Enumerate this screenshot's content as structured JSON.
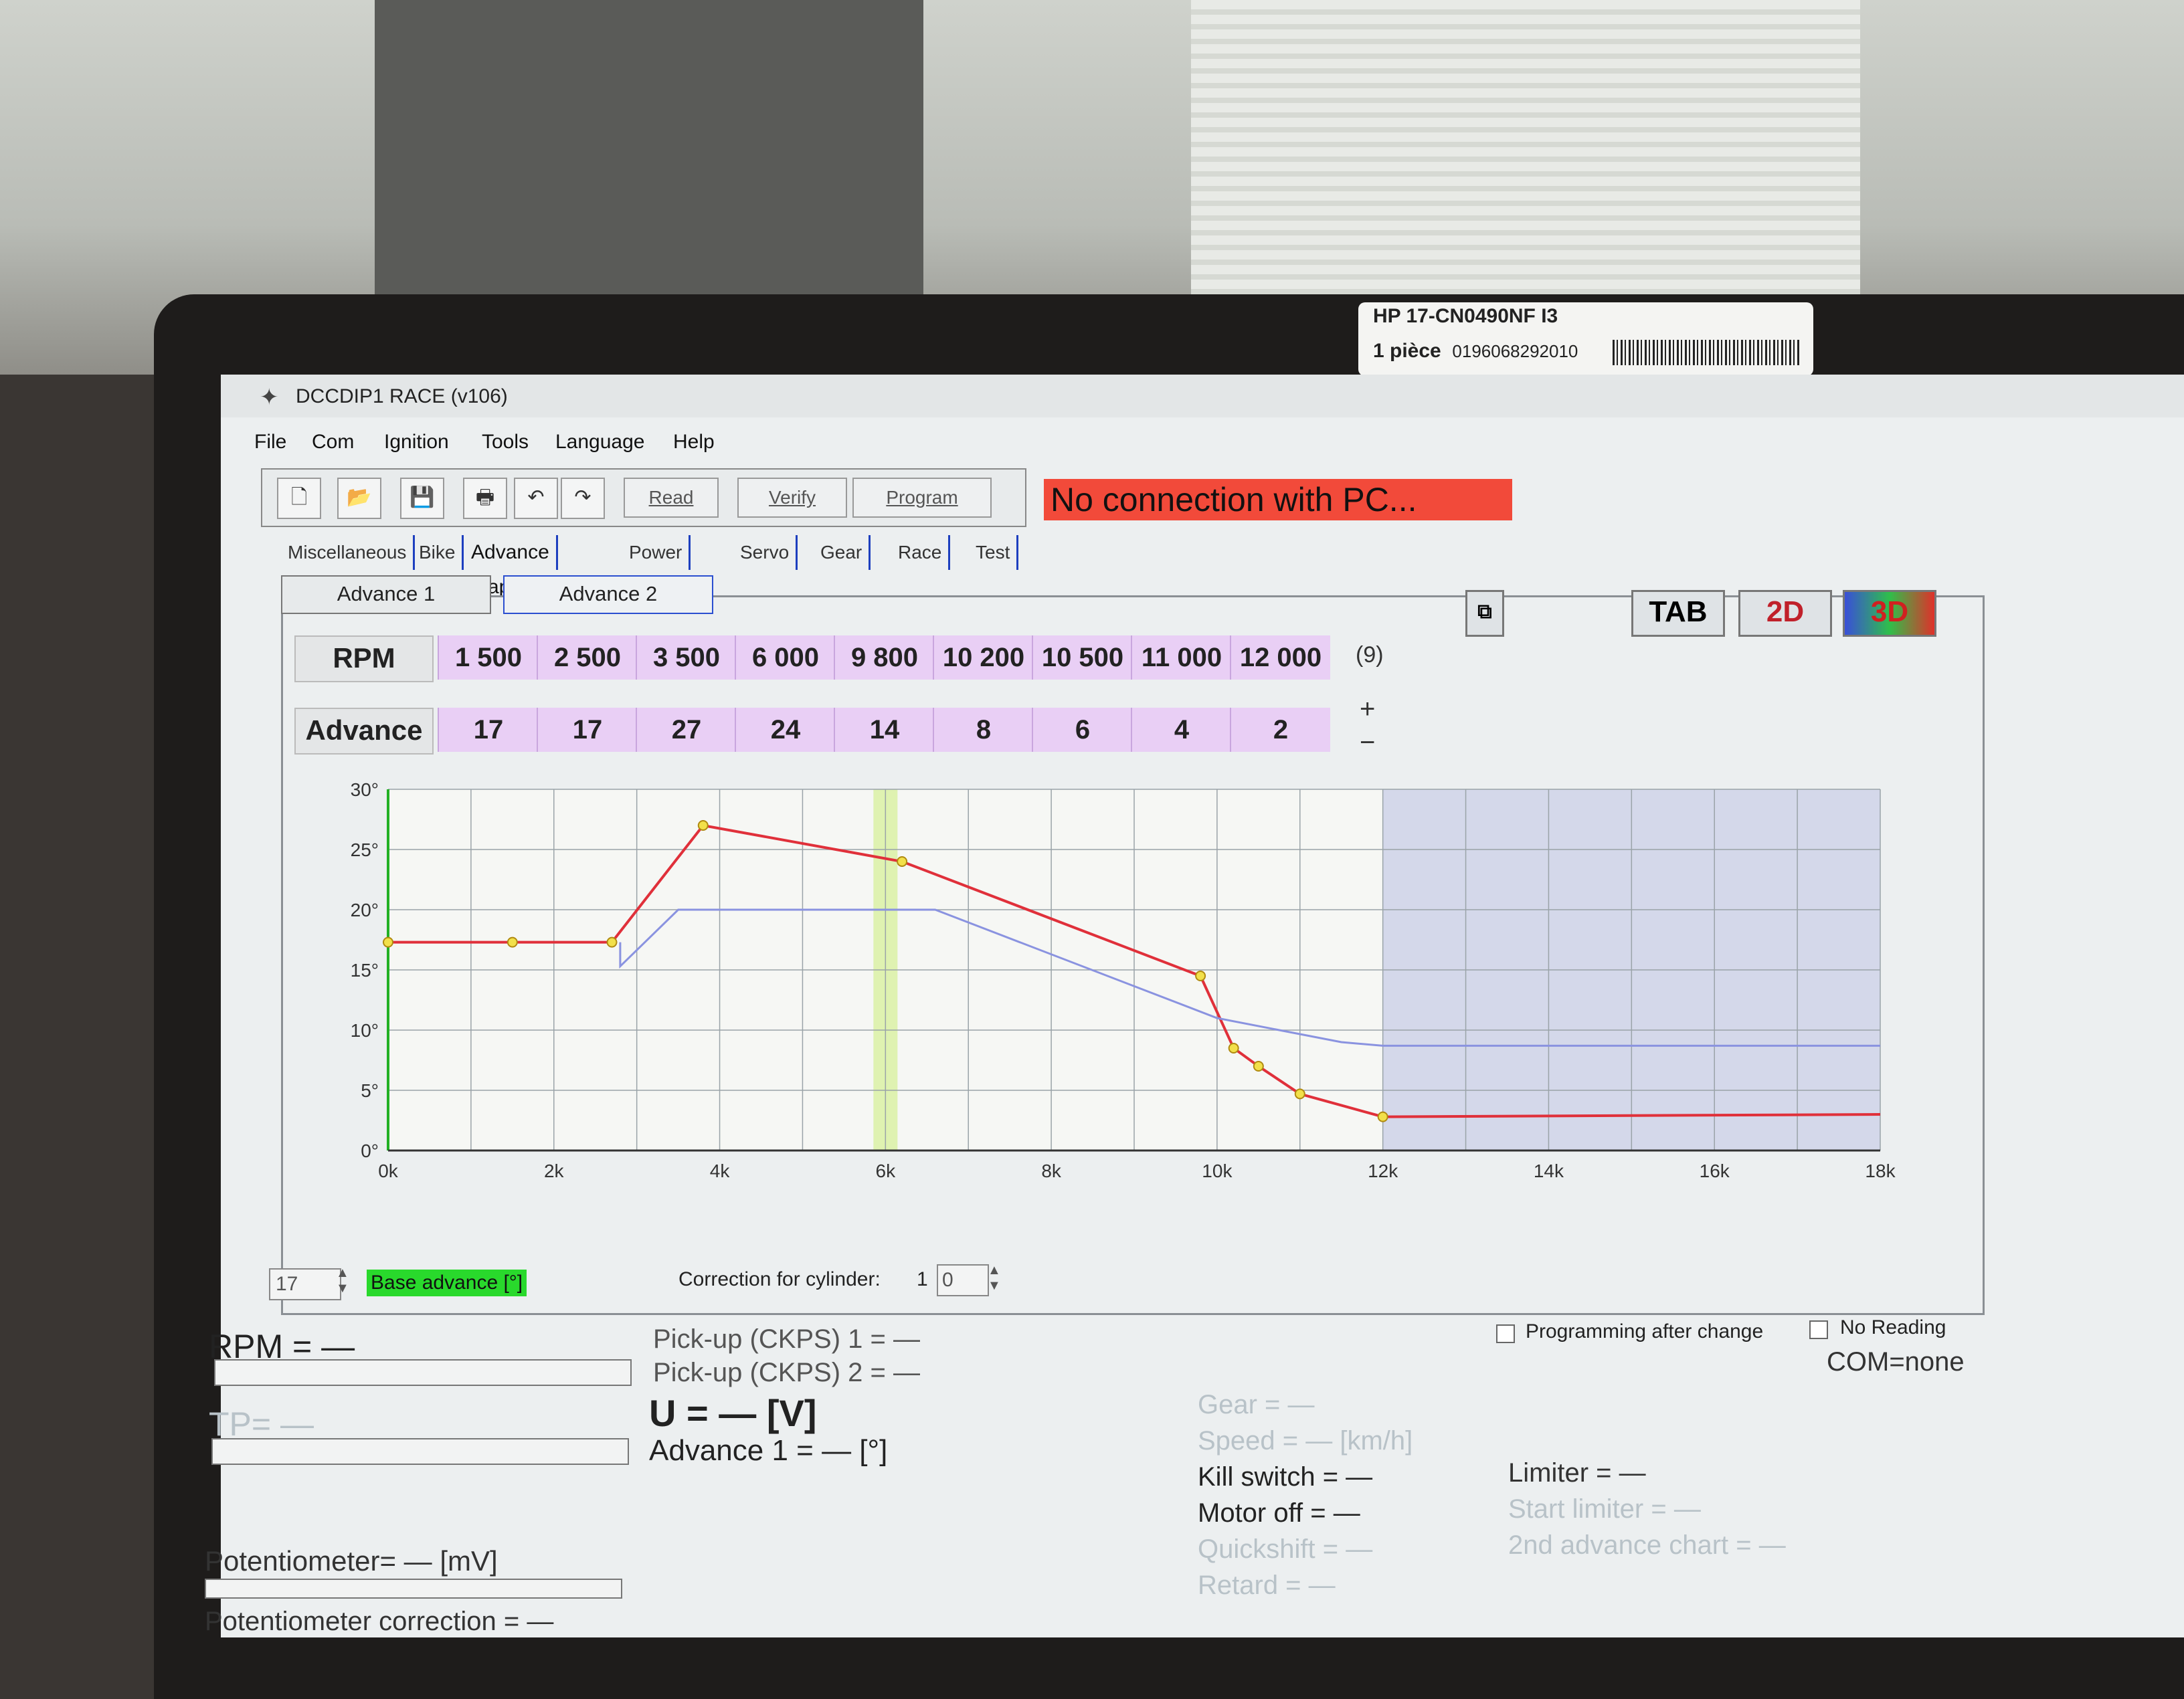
{
  "label_sticker": {
    "line1": "HP 17-CN0490NF I3",
    "line2_left": "1 pièce",
    "line2_code": "0196068292010"
  },
  "window": {
    "title": "DCCDIP1 RACE (v106)"
  },
  "menu": [
    "File",
    "Com",
    "Ignition",
    "Tools",
    "Language",
    "Help"
  ],
  "toolbar": {
    "icons": [
      "new-file-icon",
      "open-folder-icon",
      "save-icon",
      "print-icon",
      "undo-icon",
      "redo-icon"
    ],
    "read": "Read",
    "verify": "Verify",
    "program": "Program"
  },
  "status_message": "No connection with PC...",
  "tabs": [
    "Miscellaneous",
    "Bike",
    "Advance Map",
    "Power out",
    "Servo",
    "Gear",
    "Race",
    "Test"
  ],
  "active_tab": "Advance Map",
  "subtabs": [
    "Advance 1",
    "Advance 2"
  ],
  "view_buttons": {
    "copy": "copy-icon",
    "tab": "TAB",
    "two_d": "2D",
    "three_d": "3D"
  },
  "table": {
    "row1_label": "RPM",
    "row2_label": "Advance",
    "rpm": [
      "1 500",
      "2 500",
      "3 500",
      "6 000",
      "9 800",
      "10 200",
      "10 500",
      "11 000",
      "12 000"
    ],
    "advance": [
      "17",
      "17",
      "27",
      "24",
      "14",
      "8",
      "6",
      "4",
      "2"
    ],
    "count": "(9)",
    "plus": "+",
    "minus": "−"
  },
  "chart_data": {
    "type": "line",
    "x_ticks": [
      "0k",
      "2k",
      "4k",
      "6k",
      "8k",
      "10k",
      "12k",
      "14k",
      "16k",
      "18k"
    ],
    "y_ticks": [
      "0°",
      "5°",
      "10°",
      "15°",
      "20°",
      "25°",
      "30°"
    ],
    "xlim": [
      0,
      18000
    ],
    "ylim": [
      0,
      30
    ],
    "grid": true,
    "series": [
      {
        "color": "#e0303a",
        "points": [
          [
            0,
            17.3
          ],
          [
            1500,
            17.3
          ],
          [
            2700,
            17.3
          ],
          [
            3800,
            27
          ],
          [
            6200,
            24
          ],
          [
            9800,
            14.5
          ],
          [
            10200,
            8.5
          ],
          [
            10500,
            7
          ],
          [
            11000,
            4.7
          ],
          [
            12000,
            2.8
          ],
          [
            18000,
            3
          ]
        ]
      },
      {
        "color": "#8a93e0",
        "points": [
          [
            2800,
            17.3
          ],
          [
            2800,
            15.3
          ],
          [
            3500,
            20
          ],
          [
            6600,
            20
          ],
          [
            10000,
            11
          ],
          [
            11500,
            9
          ],
          [
            12000,
            8.7
          ],
          [
            18000,
            8.7
          ]
        ]
      }
    ],
    "highlight_rpm": 6000,
    "shaded_from": 12000
  },
  "base_controls": {
    "base_value": "17",
    "base_label": "Base advance [°]",
    "correction_label": "Correction for cylinder:",
    "cylinder_no": "1",
    "correction_value": "0"
  },
  "readouts": {
    "rpm": "RPM = —",
    "tp": "TP= —",
    "ckps1": "Pick-up (CKPS) 1 = —",
    "ckps2": "Pick-up (CKPS) 2 = —",
    "voltage": "U = — [V]",
    "advance1": "Advance 1 = — [°]",
    "potentiometer": "Potentiometer= — [mV]",
    "pot_correction": "Potentiometer correction = —",
    "gear": "Gear = —",
    "speed": "Speed = — [km/h]",
    "kill_switch": "Kill switch = —",
    "motor_off": "Motor off = —",
    "quickshift": "Quickshift = —",
    "retard": "Retard = —",
    "limiter": "Limiter = —",
    "start_limiter": "Start limiter = —",
    "second_advance": "2nd advance chart = —"
  },
  "options": {
    "prog_after_change": "Programming after change",
    "no_reading": "No Reading",
    "com": "COM=none"
  }
}
